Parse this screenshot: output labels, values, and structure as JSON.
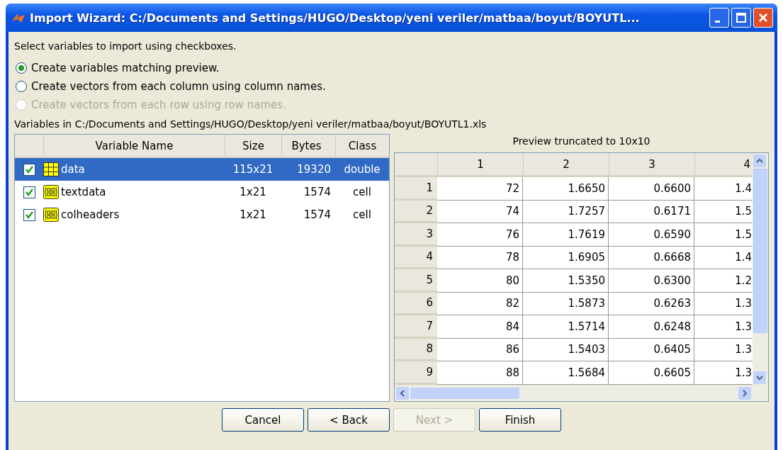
{
  "window": {
    "title": "Import Wizard: C:/Documents and Settings/HUGO/Desktop/yeni veriler/matbaa/boyut/BOYUTL..."
  },
  "instruction": "Select variables to import using checkboxes.",
  "options": [
    {
      "label": "Create variables matching preview.",
      "selected": true,
      "disabled": false
    },
    {
      "label": "Create vectors from each column using column names.",
      "selected": false,
      "disabled": false
    },
    {
      "label": "Create vectors from each row using row names.",
      "selected": false,
      "disabled": true
    }
  ],
  "variables_caption": "Variables in C:/Documents and Settings/HUGO/Desktop/yeni veriler/matbaa/boyut/BOYUTL1.xls",
  "variables": {
    "columns": [
      "Variable Name",
      "Size",
      "Bytes",
      "Class"
    ],
    "rows": [
      {
        "kind": "matrix",
        "name": "data",
        "size": "115x21",
        "bytes": "19320",
        "class": "double",
        "checked": true,
        "selected": true
      },
      {
        "kind": "cell",
        "name": "textdata",
        "size": "1x21",
        "bytes": "1574",
        "class": "cell",
        "checked": true,
        "selected": false
      },
      {
        "kind": "cell",
        "name": "colheaders",
        "size": "1x21",
        "bytes": "1574",
        "class": "cell",
        "checked": true,
        "selected": false
      }
    ]
  },
  "preview": {
    "title": "Preview truncated to 10x10",
    "columns": [
      "1",
      "2",
      "3",
      "4"
    ],
    "rows": [
      {
        "header": "1",
        "cells": [
          "72",
          "1.6650",
          "0.6600",
          "1.4"
        ]
      },
      {
        "header": "2",
        "cells": [
          "74",
          "1.7257",
          "0.6171",
          "1.5"
        ]
      },
      {
        "header": "3",
        "cells": [
          "76",
          "1.7619",
          "0.6590",
          "1.5"
        ]
      },
      {
        "header": "4",
        "cells": [
          "78",
          "1.6905",
          "0.6668",
          "1.4"
        ]
      },
      {
        "header": "5",
        "cells": [
          "80",
          "1.5350",
          "0.6300",
          "1.2"
        ]
      },
      {
        "header": "6",
        "cells": [
          "82",
          "1.5873",
          "0.6263",
          "1.3"
        ]
      },
      {
        "header": "7",
        "cells": [
          "84",
          "1.5714",
          "0.6248",
          "1.3"
        ]
      },
      {
        "header": "8",
        "cells": [
          "86",
          "1.5403",
          "0.6405",
          "1.3"
        ]
      },
      {
        "header": "9",
        "cells": [
          "88",
          "1.5684",
          "0.6605",
          "1.3"
        ]
      }
    ]
  },
  "buttons": [
    {
      "label": "Cancel",
      "disabled": false
    },
    {
      "label": "< Back",
      "disabled": false
    },
    {
      "label": "Next >",
      "disabled": true
    },
    {
      "label": "Finish",
      "disabled": false
    }
  ]
}
